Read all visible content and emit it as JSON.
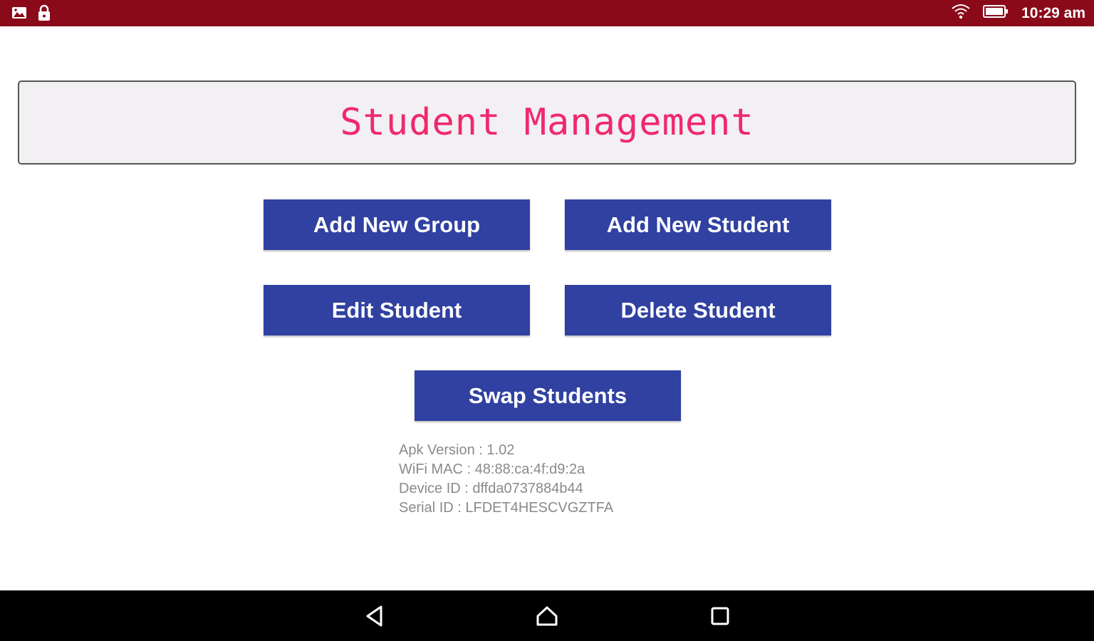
{
  "status_bar": {
    "time": "10:29 am",
    "icons": [
      "photo-icon",
      "lock-icon",
      "wifi-icon",
      "battery-icon"
    ],
    "background_color": "#8b0a1a"
  },
  "header": {
    "title": "Student Management",
    "title_color": "#f0286e"
  },
  "actions": {
    "add_group": "Add New Group",
    "add_student": "Add New Student",
    "edit_student": "Edit Student",
    "delete_student": "Delete Student",
    "swap_students": "Swap Students",
    "button_color": "#3041a1"
  },
  "device_info": {
    "apk_version": "Apk Version : 1.02",
    "wifi_mac": "WiFi MAC : 48:88:ca:4f:d9:2a",
    "device_id": "Device ID : dffda0737884b44",
    "serial_id": "Serial ID : LFDET4HESCVGZTFA"
  },
  "nav_bar": {
    "icons": [
      "back-icon",
      "home-icon",
      "recents-icon"
    ]
  }
}
